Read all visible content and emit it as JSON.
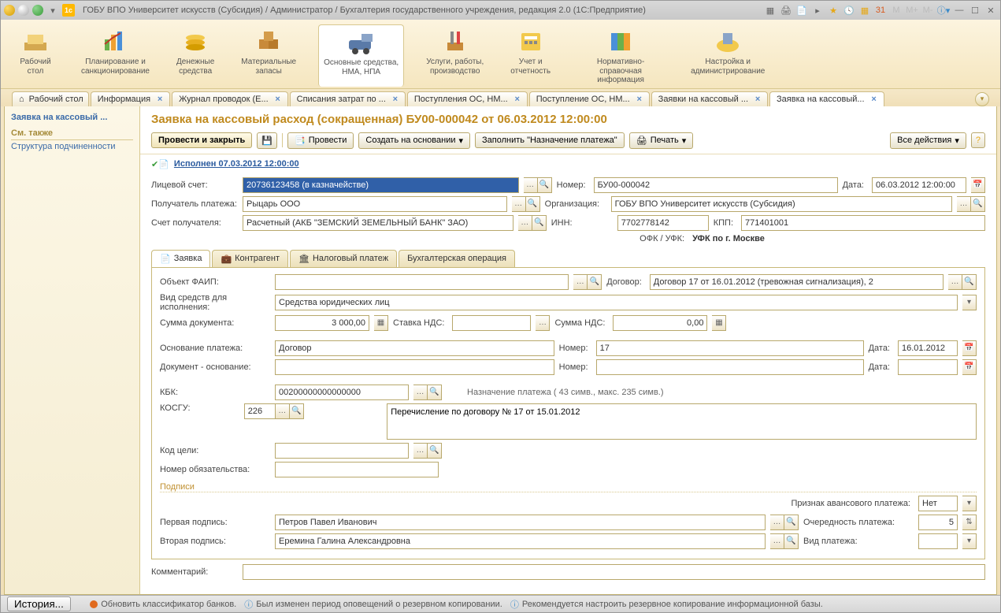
{
  "titlebar": {
    "title": "ГОБУ ВПО Университет искусств (Субсидия) / Администратор / Бухгалтерия государственного учреждения, редакция 2.0   (1С:Предприятие)"
  },
  "ribbon": [
    {
      "label": "Рабочий\nстол"
    },
    {
      "label": "Планирование и\nсанкционирование"
    },
    {
      "label": "Денежные\nсредства"
    },
    {
      "label": "Материальные\nзапасы"
    },
    {
      "label": "Основные средства,\nНМА, НПА"
    },
    {
      "label": "Услуги, работы,\nпроизводство"
    },
    {
      "label": "Учет и\nотчетность"
    },
    {
      "label": "Нормативно-справочная\nинформация"
    },
    {
      "label": "Настройка и\nадминистрирование"
    }
  ],
  "tabs": [
    {
      "label": "Рабочий стол",
      "closable": false
    },
    {
      "label": "Информация",
      "closable": true
    },
    {
      "label": "Журнал проводок (Е...",
      "closable": true
    },
    {
      "label": "Списания затрат по ...",
      "closable": true
    },
    {
      "label": "Поступления ОС, НМ...",
      "closable": true
    },
    {
      "label": "Поступление ОС, НМ...",
      "closable": true
    },
    {
      "label": "Заявки на кассовый ...",
      "closable": true
    },
    {
      "label": "Заявка на кассовый...",
      "closable": true,
      "active": true
    }
  ],
  "sidebar": {
    "current": "Заявка на кассовый ...",
    "see_also": "См. также",
    "link1": "Структура подчиненности"
  },
  "doc": {
    "title": "Заявка на кассовый расход (сокращенная) БУ00-000042 от 06.03.2012 12:00:00",
    "toolbar": {
      "post_close": "Провести и закрыть",
      "post": "Провести",
      "create_based": "Создать на основании",
      "fill_payment": "Заполнить \"Назначение платежа\"",
      "print": "Печать",
      "all_actions": "Все действия"
    },
    "executed": "Исполнен 07.03.2012 12:00:00",
    "fields": {
      "account_label": "Лицевой счет:",
      "account": "20736123458 (в казначействе)",
      "number_label": "Номер:",
      "number": "БУ00-000042",
      "date_label": "Дата:",
      "date": "06.03.2012 12:00:00",
      "recipient_label": "Получатель платежа:",
      "recipient": "Рыцарь ООО",
      "org_label": "Организация:",
      "org": "ГОБУ ВПО Университет искусств (Субсидия)",
      "recip_bank_label": "Счет получателя:",
      "recip_bank": "Расчетный (АКБ \"ЗЕМСКИЙ ЗЕМЕЛЬНЫЙ БАНК\" ЗАО)",
      "inn_label": "ИНН:",
      "inn": "7702778142",
      "kpp_label": "КПП:",
      "kpp": "771401001",
      "ofk_label": "ОФК / УФК:",
      "ofk": "УФК по г. Москве"
    },
    "subtabs": [
      "Заявка",
      "Контрагент",
      "Налоговый платеж",
      "Бухгалтерская операция"
    ],
    "request": {
      "faip_label": "Объект ФАИП:",
      "faip": "",
      "contract_label": "Договор:",
      "contract": "Договор 17 от 16.01.2012 (тревожная сигнализация), 2",
      "funds_label": "Вид средств для исполнения:",
      "funds": "Средства юридических лиц",
      "sum_label": "Сумма документа:",
      "sum": "3 000,00",
      "vat_rate_label": "Ставка НДС:",
      "vat_rate": "",
      "vat_sum_label": "Сумма НДС:",
      "vat_sum": "0,00",
      "basis_label": "Основание платежа:",
      "basis": "Договор",
      "basis_num_label": "Номер:",
      "basis_num": "17",
      "basis_date_label": "Дата:",
      "basis_date": "16.01.2012",
      "doc_basis_label": "Документ - основание:",
      "doc_basis": "",
      "doc_basis_num": "",
      "doc_basis_date": "",
      "kbk_label": "КБК:",
      "kbk": "00200000000000000",
      "purpose_hint": "Назначение платежа ( 43 симв., макс. 235 симв.)",
      "kosgu_label": "КОСГУ:",
      "kosgu": "226",
      "purpose": "Перечисление по договору № 17 от 15.01.2012",
      "target_label": "Код цели:",
      "target": "",
      "obligation_label": "Номер обязательства:",
      "obligation": "",
      "signatures": "Подписи",
      "advance_label": "Признак авансового платежа:",
      "advance": "Нет",
      "sign1_label": "Первая подпись:",
      "sign1": "Петров Павел Иванович",
      "priority_label": "Очередность платежа:",
      "priority": "5",
      "sign2_label": "Вторая подпись:",
      "sign2": "Еремина Галина Александровна",
      "paytype_label": "Вид платежа:",
      "paytype": "",
      "comment_label": "Комментарий:",
      "comment": ""
    }
  },
  "statusbar": {
    "history": "История...",
    "msg1": "Обновить классификатор банков.",
    "msg2": "Был изменен период оповещений о резервном копировании.",
    "msg3": "Рекомендуется настроить резервное копирование информационной базы."
  }
}
